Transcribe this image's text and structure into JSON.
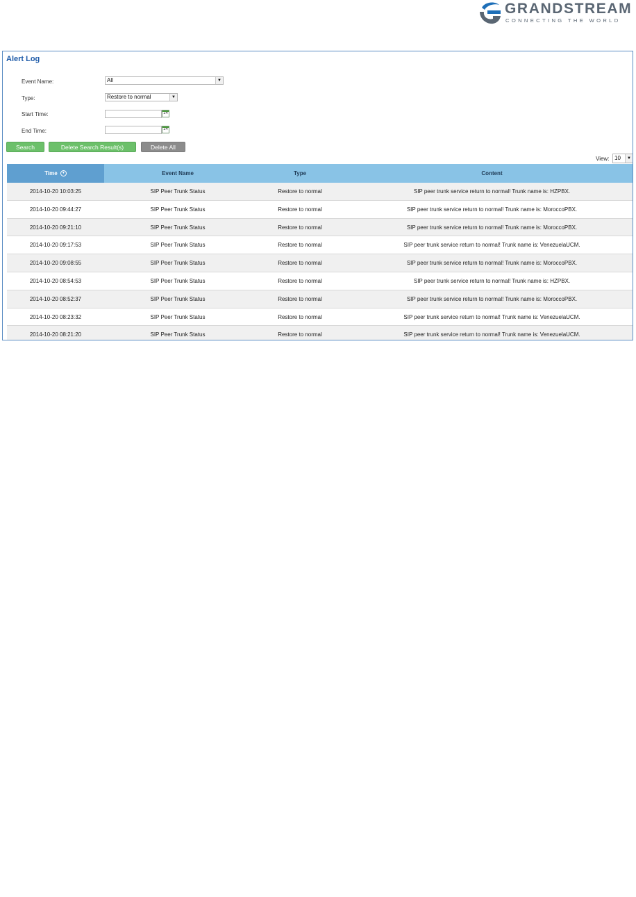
{
  "brand": {
    "name": "GRANDSTREAM",
    "tagline": "CONNECTING THE WORLD",
    "colors": {
      "mark_blue": "#1e6fb8",
      "mark_gray": "#5a6673"
    }
  },
  "panel": {
    "title": "Alert Log"
  },
  "form": {
    "event_name_label": "Event Name:",
    "event_name_value": "All",
    "type_label": "Type:",
    "type_value": "Restore to normal",
    "start_time_label": "Start Time:",
    "start_time_value": "",
    "end_time_label": "End Time:",
    "end_time_value": "",
    "calendar_day": "14"
  },
  "buttons": {
    "search": "Search",
    "delete_search_results": "Delete Search Result(s)",
    "delete_all": "Delete All"
  },
  "view": {
    "label": "View:",
    "value": "10"
  },
  "table": {
    "columns": [
      "Time",
      "Event Name",
      "Type",
      "Content"
    ],
    "rows": [
      {
        "time": "2014-10-20 10:03:25",
        "event": "SIP Peer Trunk Status",
        "type": "Restore to normal",
        "content": "SIP peer trunk service return to normal! Trunk name is: HZPBX."
      },
      {
        "time": "2014-10-20 09:44:27",
        "event": "SIP Peer Trunk Status",
        "type": "Restore to normal",
        "content": "SIP peer trunk service return to normal! Trunk name is: MoroccoPBX."
      },
      {
        "time": "2014-10-20 09:21:10",
        "event": "SIP Peer Trunk Status",
        "type": "Restore to normal",
        "content": "SIP peer trunk service return to normal! Trunk name is: MoroccoPBX."
      },
      {
        "time": "2014-10-20 09:17:53",
        "event": "SIP Peer Trunk Status",
        "type": "Restore to normal",
        "content": "SIP peer trunk service return to normal! Trunk name is: VenezuelaUCM."
      },
      {
        "time": "2014-10-20 09:08:55",
        "event": "SIP Peer Trunk Status",
        "type": "Restore to normal",
        "content": "SIP peer trunk service return to normal! Trunk name is: MoroccoPBX."
      },
      {
        "time": "2014-10-20 08:54:53",
        "event": "SIP Peer Trunk Status",
        "type": "Restore to normal",
        "content": "SIP peer trunk service return to normal! Trunk name is: HZPBX."
      },
      {
        "time": "2014-10-20 08:52:37",
        "event": "SIP Peer Trunk Status",
        "type": "Restore to normal",
        "content": "SIP peer trunk service return to normal! Trunk name is: MoroccoPBX."
      },
      {
        "time": "2014-10-20 08:23:32",
        "event": "SIP Peer Trunk Status",
        "type": "Restore to normal",
        "content": "SIP peer trunk service return to normal! Trunk name is: VenezuelaUCM."
      },
      {
        "time": "2014-10-20 08:21:20",
        "event": "SIP Peer Trunk Status",
        "type": "Restore to normal",
        "content": "SIP peer trunk service return to normal! Trunk name is: VenezuelaUCM."
      }
    ]
  }
}
